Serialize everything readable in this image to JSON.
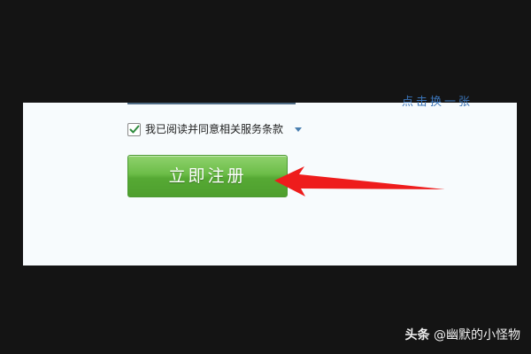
{
  "form": {
    "refresh_link": "点击换一张",
    "agree_label": "我已阅读并同意相关服务条款",
    "agree_checked": true,
    "register_button": "立即注册"
  },
  "watermark": {
    "brand": "头条",
    "author": "@幽默的小怪物"
  },
  "colors": {
    "button_green": "#6cbd48",
    "annotation_arrow": "#ee1c1c",
    "link_blue": "#3a74b8"
  }
}
